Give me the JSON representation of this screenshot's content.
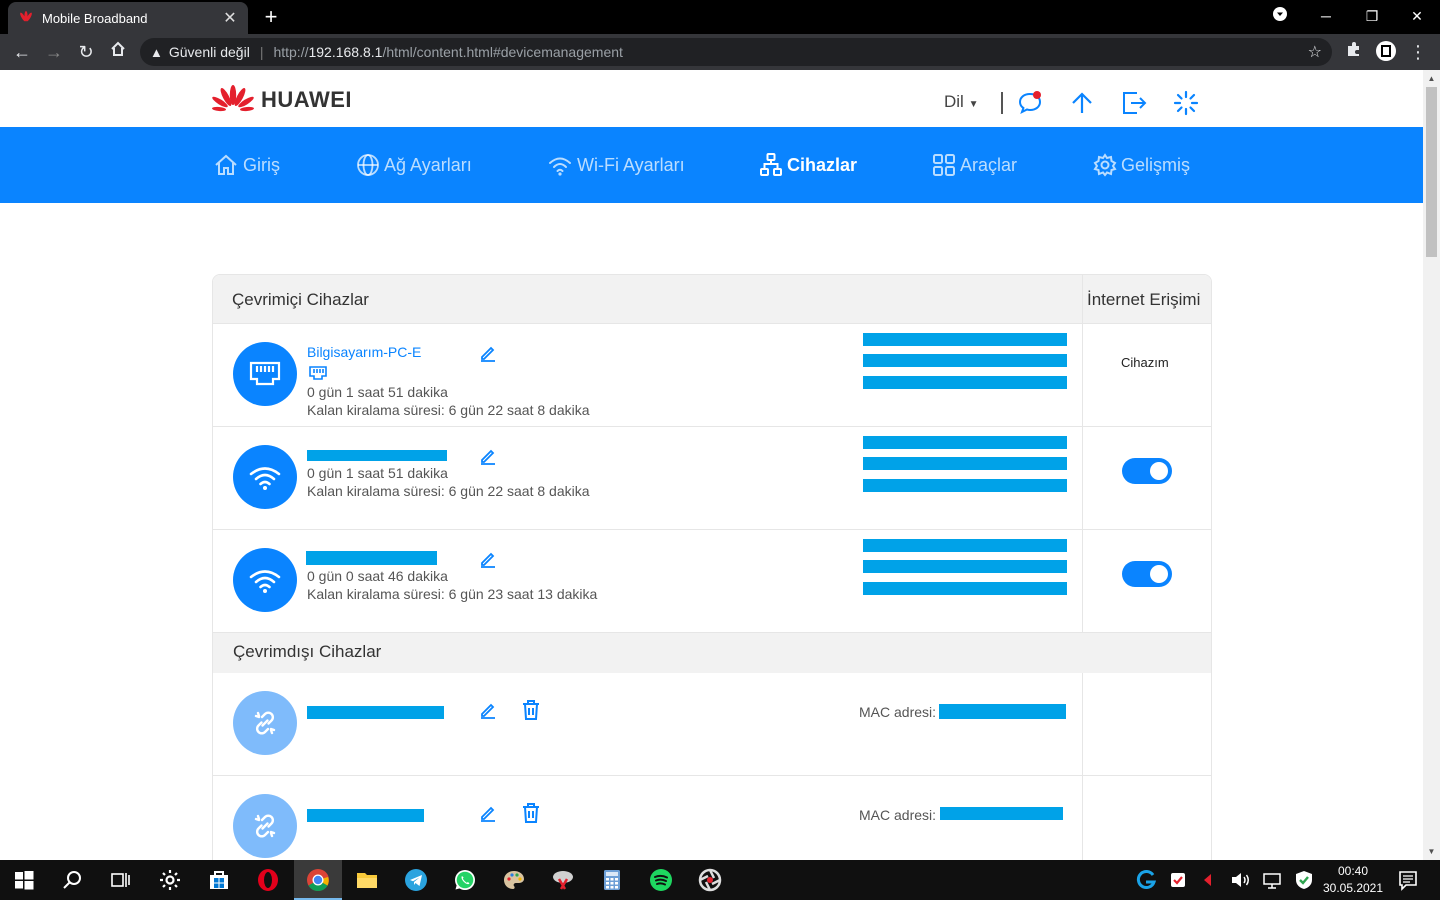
{
  "browser": {
    "tab_title": "Mobile Broadband",
    "tab_close": "✕",
    "new_tab": "+",
    "security_label": "Güvenli değil",
    "url_prefix": "http://",
    "url_host": "192.168.8.1",
    "url_path": "/html/content.html#devicemanagement"
  },
  "header": {
    "logo_text": "HUAWEI",
    "language_label": "Dil"
  },
  "nav": [
    {
      "label": "Giriş",
      "icon": "home-icon"
    },
    {
      "label": "Ağ Ayarları",
      "icon": "globe-icon"
    },
    {
      "label": "Wi-Fi Ayarları",
      "icon": "wifi-icon"
    },
    {
      "label": "Cihazlar",
      "icon": "devices-icon",
      "active": true
    },
    {
      "label": "Araçlar",
      "icon": "tools-icon"
    },
    {
      "label": "Gelişmiş",
      "icon": "gear-icon"
    }
  ],
  "table": {
    "online_title": "Çevrimiçi Cihazlar",
    "internet_access_title": "İnternet Erişimi",
    "offline_title": "Çevrimdışı Cihazlar",
    "online_devices": [
      {
        "name": "Bilgisayarım-PC-E",
        "connection": "ethernet",
        "uptime": "0 gün 1 saat 51 dakika",
        "lease": "Kalan kiralama süresi: 6 gün 22 saat 8 dakika",
        "access_label": "Cihazım"
      },
      {
        "name": "",
        "connection": "wifi",
        "uptime": "0 gün 1 saat 51 dakika",
        "lease": "Kalan kiralama süresi: 6 gün 22 saat 8 dakika",
        "access_enabled": true
      },
      {
        "name": "",
        "connection": "wifi",
        "uptime": "0 gün 0 saat 46 dakika",
        "lease": "Kalan kiralama süresi: 6 gün 23 saat 13 dakika",
        "access_enabled": true
      }
    ],
    "offline_devices": [
      {
        "mac_label": "MAC adresi:"
      },
      {
        "mac_label": "MAC adresi:"
      }
    ]
  },
  "taskbar": {
    "time": "00:40",
    "date": "30.05.2021"
  },
  "colors": {
    "brand_blue": "#0a84ff",
    "redaction": "#00a2e8",
    "huawei_red": "#e4202d"
  }
}
